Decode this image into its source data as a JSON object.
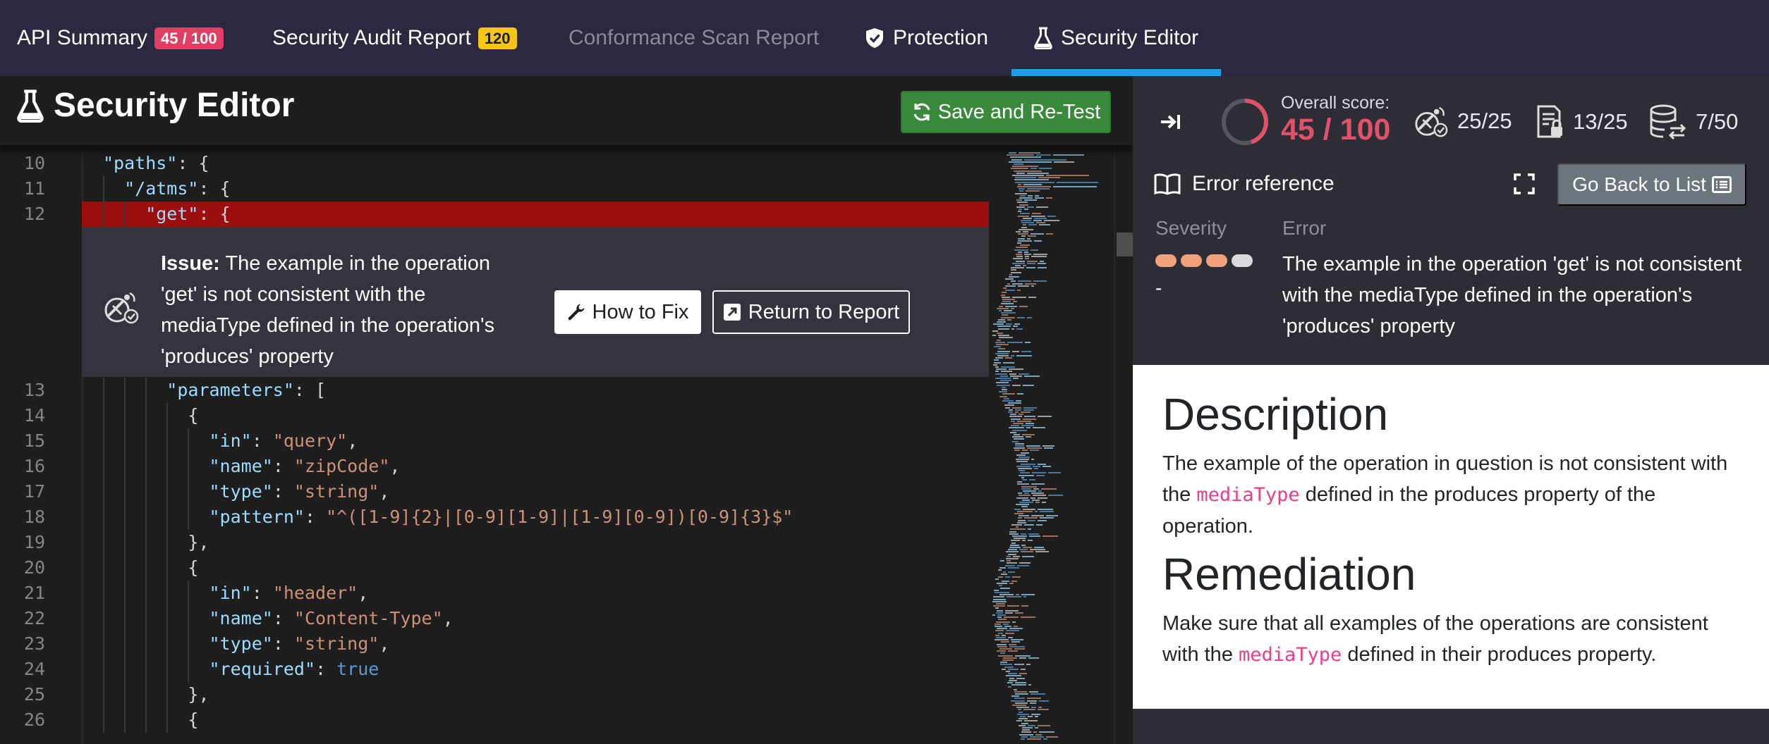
{
  "tabs": [
    {
      "label": "API Summary",
      "badge": "45 / 100",
      "badge_color": "#e03e63"
    },
    {
      "label": "Security Audit Report",
      "badge": "120",
      "badge_color": "#f5c518"
    },
    {
      "label": "Conformance Scan Report",
      "disabled": true
    },
    {
      "label": "Protection",
      "icon": "shield-check-icon"
    },
    {
      "label": "Security Editor",
      "icon": "flask-icon",
      "active": true
    }
  ],
  "editor": {
    "title": "Security Editor",
    "save_button": "Save and Re-Test",
    "lines_top": [
      {
        "num": "10",
        "indent": 1,
        "tokens": [
          [
            "k",
            "\"paths\""
          ],
          [
            "p",
            ": {"
          ]
        ]
      },
      {
        "num": "11",
        "indent": 2,
        "tokens": [
          [
            "k",
            "\"/atms\""
          ],
          [
            "p",
            ": {"
          ]
        ]
      },
      {
        "num": "12",
        "indent": 3,
        "tokens": [
          [
            "k",
            "\"get\""
          ],
          [
            "p",
            ": {"
          ]
        ],
        "highlight": true
      }
    ],
    "issue": {
      "label": "Issue:",
      "text": "The example in the operation 'get' is not consistent with the mediaType defined in the operation's 'produces' property",
      "how_to_fix": "How to Fix",
      "return_to_report": "Return to Report"
    },
    "lines_bottom": [
      {
        "num": "13",
        "indent": 4,
        "tokens": [
          [
            "k",
            "\"parameters\""
          ],
          [
            "p",
            ": ["
          ]
        ]
      },
      {
        "num": "14",
        "indent": 5,
        "tokens": [
          [
            "p",
            "{"
          ]
        ]
      },
      {
        "num": "15",
        "indent": 6,
        "tokens": [
          [
            "k",
            "\"in\""
          ],
          [
            "p",
            ": "
          ],
          [
            "s",
            "\"query\""
          ],
          [
            "p",
            ","
          ]
        ]
      },
      {
        "num": "16",
        "indent": 6,
        "tokens": [
          [
            "k",
            "\"name\""
          ],
          [
            "p",
            ": "
          ],
          [
            "s",
            "\"zipCode\""
          ],
          [
            "p",
            ","
          ]
        ]
      },
      {
        "num": "17",
        "indent": 6,
        "tokens": [
          [
            "k",
            "\"type\""
          ],
          [
            "p",
            ": "
          ],
          [
            "s",
            "\"string\""
          ],
          [
            "p",
            ","
          ]
        ]
      },
      {
        "num": "18",
        "indent": 6,
        "tokens": [
          [
            "k",
            "\"pattern\""
          ],
          [
            "p",
            ": "
          ],
          [
            "s",
            "\"^([1-9]{2}|[0-9][1-9]|[1-9][0-9])[0-9]{3}$\""
          ]
        ]
      },
      {
        "num": "19",
        "indent": 5,
        "tokens": [
          [
            "p",
            "},"
          ]
        ]
      },
      {
        "num": "20",
        "indent": 5,
        "tokens": [
          [
            "p",
            "{"
          ]
        ]
      },
      {
        "num": "21",
        "indent": 6,
        "tokens": [
          [
            "k",
            "\"in\""
          ],
          [
            "p",
            ": "
          ],
          [
            "s",
            "\"header\""
          ],
          [
            "p",
            ","
          ]
        ]
      },
      {
        "num": "22",
        "indent": 6,
        "tokens": [
          [
            "k",
            "\"name\""
          ],
          [
            "p",
            ": "
          ],
          [
            "s",
            "\"Content-Type\""
          ],
          [
            "p",
            ","
          ]
        ]
      },
      {
        "num": "23",
        "indent": 6,
        "tokens": [
          [
            "k",
            "\"type\""
          ],
          [
            "p",
            ": "
          ],
          [
            "s",
            "\"string\""
          ],
          [
            "p",
            ","
          ]
        ]
      },
      {
        "num": "24",
        "indent": 6,
        "tokens": [
          [
            "k",
            "\"required\""
          ],
          [
            "p",
            ": "
          ],
          [
            "b",
            "true"
          ]
        ]
      },
      {
        "num": "25",
        "indent": 5,
        "tokens": [
          [
            "p",
            "},"
          ]
        ]
      },
      {
        "num": "26",
        "indent": 5,
        "tokens": [
          [
            "p",
            "{"
          ]
        ]
      }
    ]
  },
  "score": {
    "label": "Overall score:",
    "value": "45 / 100",
    "fraction": 0.45,
    "color": "#e0516b",
    "metrics": [
      {
        "icon": "satellite-check-icon",
        "value": "25/25"
      },
      {
        "icon": "document-lock-icon",
        "value": "13/25"
      },
      {
        "icon": "database-transfer-icon",
        "value": "7/50"
      }
    ]
  },
  "error_reference": {
    "title": "Error reference",
    "back_button": "Go Back to List",
    "severity_label": "Severity",
    "error_label": "Error",
    "severity_level": 3,
    "severity_max": 4,
    "severity_text": "-",
    "error_text": "The example in the operation 'get' is not consistent with the mediaType defined in the operation's 'produces' property"
  },
  "description": {
    "heading": "Description",
    "text_before": "The example of the operation in question is not consistent with the ",
    "code": "mediaType",
    "text_after": " defined in the produces property of the operation.",
    "remediation_heading": "Remediation",
    "rem_before": "Make sure that all examples of the operations are consistent with the ",
    "rem_code": "mediaType",
    "rem_after": " defined in their produces property."
  }
}
